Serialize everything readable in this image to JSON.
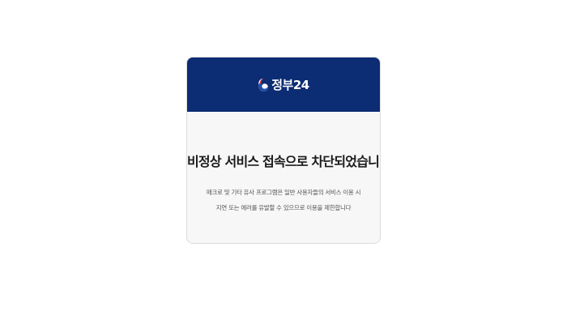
{
  "header": {
    "logo_text": "정부24",
    "logo_icon": "government-emblem-icon",
    "background_color": "#0c2c73"
  },
  "message": {
    "title": "비정상 서비스 접속으로 차단되었습니다.",
    "description_line1": "매크로 및 기타 유사 프로그램은 일반 사용자들의 서비스 이용 시",
    "description_line2": "지연 또는 에러를 유발할 수 있으므로 이용을 제한합니다"
  }
}
